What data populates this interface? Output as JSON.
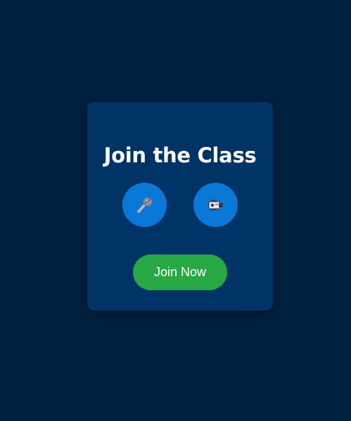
{
  "card": {
    "title": "Join the Class"
  },
  "controls": {
    "microphone_icon": "microphone-icon",
    "camera_icon": "video-camera-icon"
  },
  "join_button": {
    "label": "Join Now"
  },
  "colors": {
    "background": "#00203f",
    "card": "#003366",
    "icon_button": "#0a78d7",
    "join_button": "#28a745",
    "text": "#ffffff"
  }
}
